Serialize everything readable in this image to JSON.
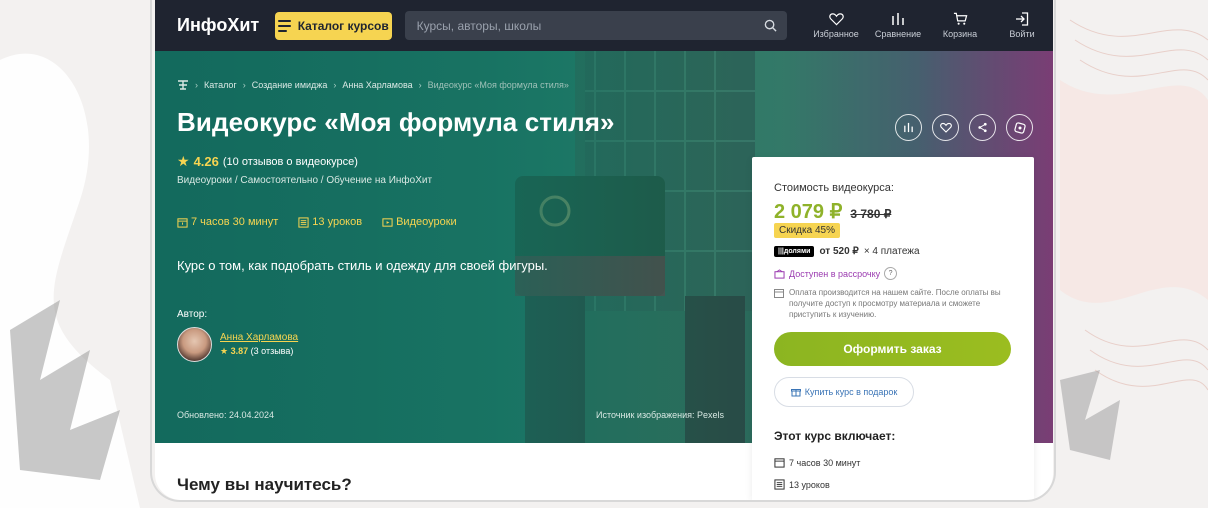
{
  "header": {
    "logo": "ИнфоХит",
    "catalog_label": "Каталог курсов",
    "search_placeholder": "Курсы, авторы, школы",
    "nav": [
      {
        "label": "Избранное",
        "icon": "heart-icon"
      },
      {
        "label": "Сравнение",
        "icon": "compare-icon"
      },
      {
        "label": "Корзина",
        "icon": "cart-icon"
      },
      {
        "label": "Войти",
        "icon": "login-icon"
      }
    ]
  },
  "breadcrumbs": [
    "Каталог",
    "Создание имиджа",
    "Анна Харламова",
    "Видеокурс «Моя формула стиля»"
  ],
  "course": {
    "title": "Видеокурс «Моя формула стиля»",
    "rating": "4.26",
    "reviews": "(10 отзывов о видеокурсе)",
    "tags": "Видеоуроки / Самостоятельно / Обучение на ИнфоХит",
    "duration": "7 часов 30 минут",
    "lessons": "13 уроков",
    "format": "Видеоуроки",
    "description": "Курс о том, как подобрать стиль и одежду для своей фигуры.",
    "author_label": "Автор:",
    "author_name": "Анна Харламова",
    "author_rating": "3.87",
    "author_reviews": "(3 отзыва)",
    "updated": "Обновлено: 24.04.2024",
    "image_source": "Источник изображения: Pexels"
  },
  "price_card": {
    "label": "Стоимость видеокурса:",
    "price": "2 079 ₽",
    "old_price": "3 780 ₽",
    "discount": "Скидка 45%",
    "dolyami": "|||долями",
    "installment_from": "от 520 ₽",
    "installment_rest": "× 4 платежа",
    "rassrochka": "Доступен в рассрочку",
    "payment_note": "Оплата производится на нашем сайте. После оплаты вы получите доступ к просмотру материала и сможете приступить к изучению.",
    "order_button": "Оформить заказ",
    "gift_button": "Купить курс в подарок",
    "includes_title": "Этот курс включает:",
    "includes": [
      "7 часов 30 минут",
      "13 уроков"
    ]
  },
  "learn_title": "Чему вы научитесь?",
  "colors": {
    "accent_yellow": "#f6d451",
    "accent_green": "#8fb22a",
    "header_bg": "#1f2430",
    "hero_teal": "#1c6f64"
  }
}
